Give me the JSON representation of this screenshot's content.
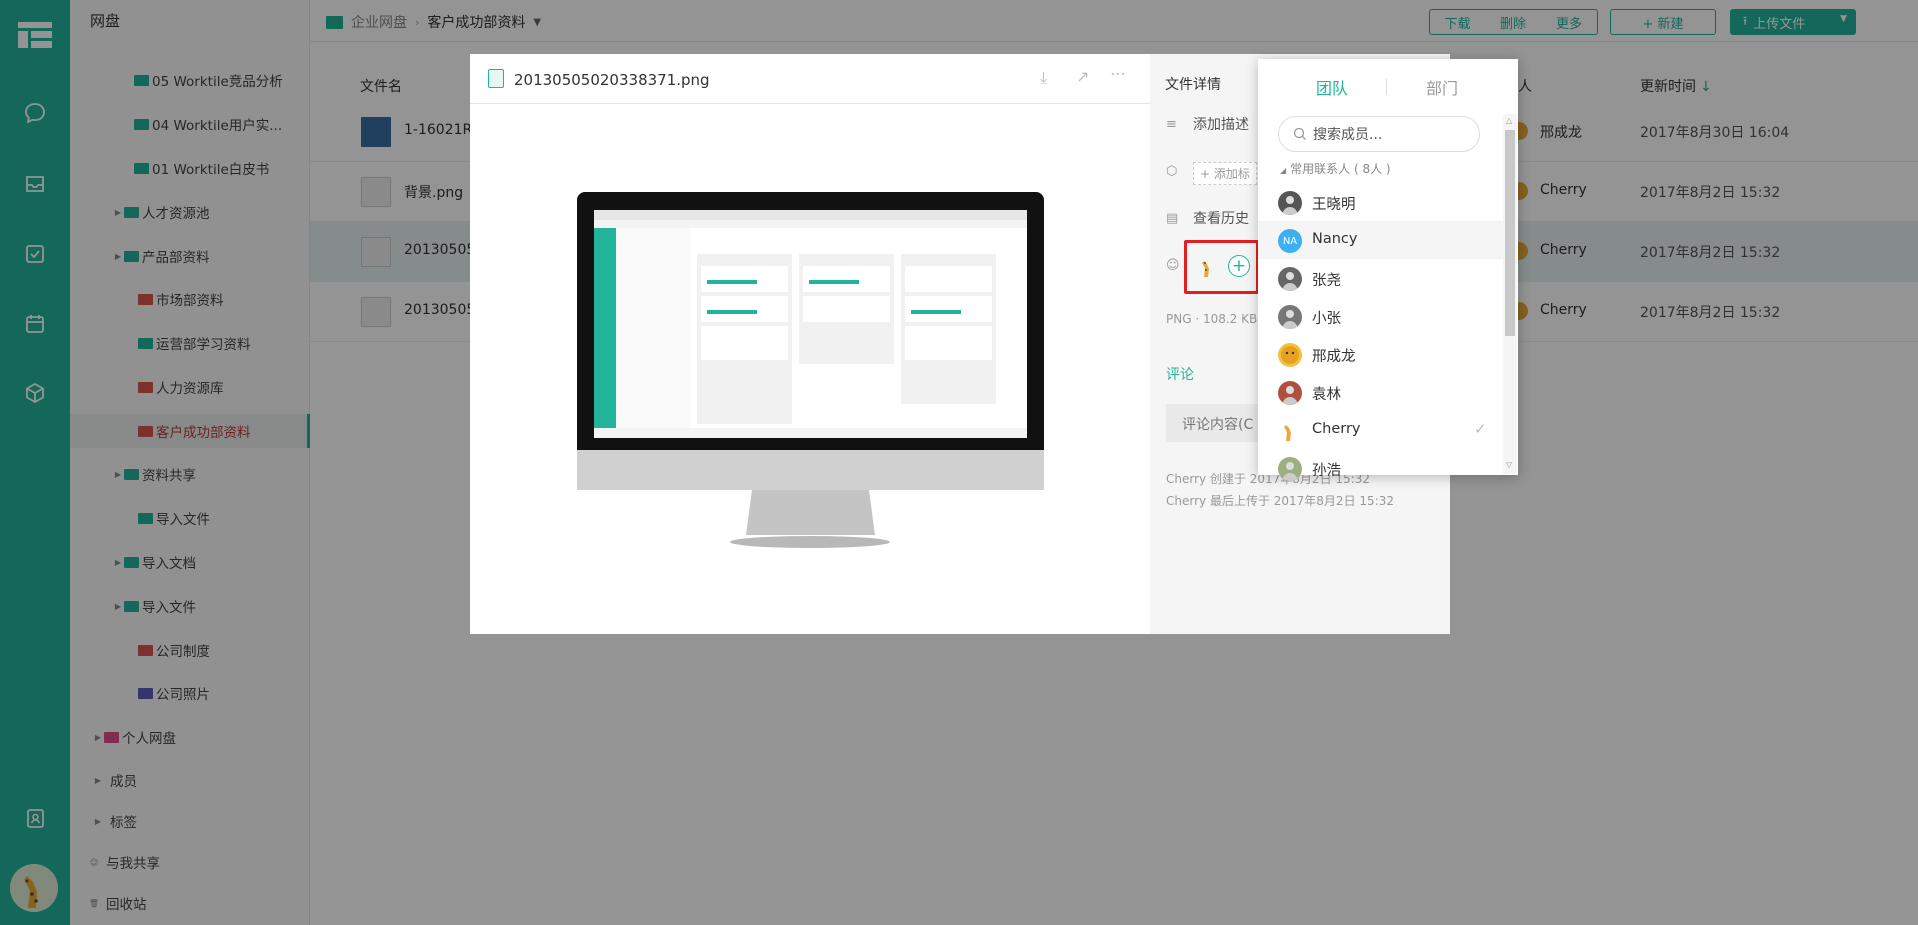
{
  "sidebar": {
    "title": "网盘",
    "items": [
      {
        "label": "05 Worktile竞品分析",
        "color": "#22b49a"
      },
      {
        "label": "04 Worktile用户实...",
        "color": "#22b49a"
      },
      {
        "label": "01 Worktile白皮书",
        "color": "#22b49a"
      },
      {
        "label": "人才资源池",
        "color": "#22b49a"
      },
      {
        "label": "产品部资料",
        "color": "#22b49a"
      },
      {
        "label": "市场部资料",
        "color": "#d9534f"
      },
      {
        "label": "运营部学习资料",
        "color": "#22b49a"
      },
      {
        "label": "人力资源库",
        "color": "#d9534f"
      },
      {
        "label": "客户成功部资料",
        "color": "#d9534f"
      },
      {
        "label": "资料共享",
        "color": "#22b49a"
      },
      {
        "label": "导入文件",
        "color": "#22b49a"
      },
      {
        "label": "导入文档",
        "color": "#22b49a"
      },
      {
        "label": "导入文件",
        "color": "#22b49a"
      },
      {
        "label": "公司制度",
        "color": "#d9534f"
      },
      {
        "label": "公司照片",
        "color": "#5b5bc0"
      },
      {
        "label": "个人网盘",
        "color": "#e04c8a"
      },
      {
        "label": "成员",
        "color": ""
      },
      {
        "label": "标签",
        "color": ""
      },
      {
        "label": "与我共享",
        "color": ""
      },
      {
        "label": "回收站",
        "color": ""
      }
    ]
  },
  "breadcrumb": {
    "root": "企业网盘",
    "current": "客户成功部资料"
  },
  "toolbar": {
    "download": "下载",
    "delete": "删除",
    "more": "更多",
    "new": "+ 新建",
    "upload": "上传文件"
  },
  "table": {
    "col_name": "文件名",
    "col_updater": "更新人",
    "col_time": "更新时间",
    "rows": [
      {
        "name": "1-16021R",
        "updater": "邢成龙",
        "time": "2017年8月30日 16:04"
      },
      {
        "name": "背景.png",
        "updater": "Cherry",
        "time": "2017年8月2日 15:32"
      },
      {
        "name": "20130505",
        "updater": "Cherry",
        "time": "2017年8月2日 15:32"
      },
      {
        "name": "20130505",
        "updater": "Cherry",
        "time": "2017年8月2日 15:32"
      }
    ]
  },
  "preview": {
    "filename": "20130505020338371.png",
    "details_title": "文件详情",
    "add_desc": "添加描述",
    "add_tag": "+ 添加标",
    "view_history": "查看历史",
    "fileinfo": "PNG · 108.2 KB",
    "comment_title": "评论",
    "comment_placeholder": "评论内容(C",
    "created": "Cherry 创建于 2017年8月2日 15:32",
    "uploaded": "Cherry 最后上传于 2017年8月2日 15:32"
  },
  "member_popup": {
    "tab_team": "团队",
    "tab_dept": "部门",
    "search_placeholder": "搜索成员...",
    "group_label": "常用联系人 ( 8人 )",
    "members": [
      {
        "name": "王晓明",
        "avatar": "photo",
        "checked": false
      },
      {
        "name": "Nancy",
        "avatar": "NA",
        "checked": false
      },
      {
        "name": "张尧",
        "avatar": "photo",
        "checked": false
      },
      {
        "name": "小张",
        "avatar": "photo",
        "checked": false
      },
      {
        "name": "邢成龙",
        "avatar": "tiger",
        "checked": false
      },
      {
        "name": "袁林",
        "avatar": "photo",
        "checked": false
      },
      {
        "name": "Cherry",
        "avatar": "giraffe",
        "checked": true
      },
      {
        "name": "孙浩",
        "avatar": "photo",
        "checked": false
      }
    ]
  },
  "colors": {
    "accent": "#22b49a",
    "highlight_box": "#e02020"
  }
}
